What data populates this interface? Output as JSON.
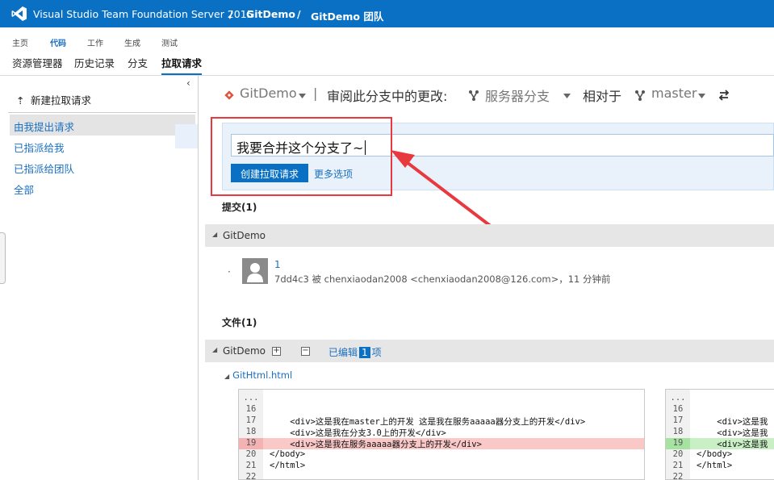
{
  "topbar": {
    "product": "Visual Studio Team Foundation Server 2015",
    "sep1": "/",
    "project": "GitDemo",
    "sep2": "/",
    "team": "GitDemo 团队"
  },
  "hubs": {
    "top": [
      "主页",
      "代码",
      "工作",
      "生成",
      "测试"
    ],
    "active_top": "代码",
    "sub": [
      "资源管理器",
      "历史记录",
      "分支",
      "拉取请求"
    ],
    "active_sub": "拉取请求"
  },
  "left": {
    "collapse": "‹",
    "new_pr": "新建拉取请求",
    "items": [
      "由我提出请求",
      "已指派给我",
      "已指派给团队",
      "全部"
    ]
  },
  "header": {
    "repo": "GitDemo",
    "divider": "|",
    "review_text": "审阅此分支中的更改:",
    "source_branch": "服务器分支",
    "relative": "相对于",
    "target_branch": "master"
  },
  "form": {
    "title_value": "我要合并这个分支了~",
    "create_button": "创建拉取请求",
    "more_options": "更多选项"
  },
  "commits": {
    "heading": "提交(1)",
    "repo": "GitDemo",
    "items": [
      {
        "dot": "·",
        "message": "1",
        "meta": "7dd4c3 被 chenxiaodan2008 <chenxiaodan2008@126.com>，11 分钟前"
      }
    ]
  },
  "files": {
    "heading": "文件(1)",
    "repo": "GitDemo",
    "expand": "+",
    "collapse": "−",
    "edited_prefix": "已编辑",
    "edited_count": "1",
    "edited_suffix": "项",
    "file_name": "GitHtml.html"
  },
  "diff_left": [
    {
      "num": "...",
      "code": "",
      "type": "ctx"
    },
    {
      "num": "16",
      "code": "",
      "type": "ctx"
    },
    {
      "num": "17",
      "code": "    <div>这是我在master上的开发 这是我在服务aaaaa器分支上的开发</div>",
      "type": "ctx"
    },
    {
      "num": "18",
      "code": "    <div>这是我在分支3.0上的开发</div>",
      "type": "ctx"
    },
    {
      "num": "19",
      "code": "    <div>这是我在服务aaaaa器分支上的开发</div>",
      "type": "del"
    },
    {
      "num": "20",
      "code": "</body>",
      "type": "ctx"
    },
    {
      "num": "21",
      "code": "</html>",
      "type": "ctx"
    },
    {
      "num": "22",
      "code": "",
      "type": "ctx"
    }
  ],
  "diff_right": [
    {
      "num": "...",
      "code": "",
      "type": "ctx"
    },
    {
      "num": "16",
      "code": "",
      "type": "ctx"
    },
    {
      "num": "17",
      "code": "    <div>这是我",
      "type": "ctx"
    },
    {
      "num": "18",
      "code": "    <div>这是我",
      "type": "ctx"
    },
    {
      "num": "19",
      "code": "    <div>这是我",
      "type": "add"
    },
    {
      "num": "20",
      "code": "</body>",
      "type": "ctx"
    },
    {
      "num": "21",
      "code": "</html>",
      "type": "ctx"
    },
    {
      "num": "22",
      "code": "",
      "type": "ctx"
    }
  ],
  "colors": {
    "brand": "#0a70c3",
    "annotation": "#e8393f",
    "deleted": "#fbc8c8",
    "added": "#c9f0c5"
  }
}
